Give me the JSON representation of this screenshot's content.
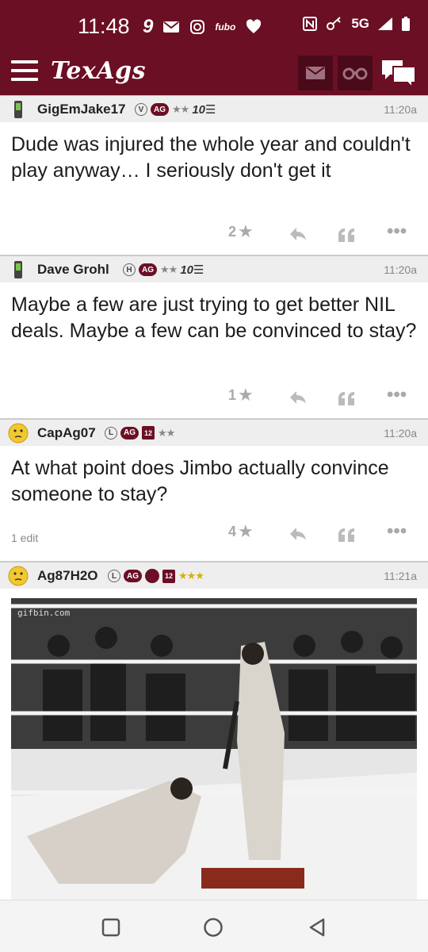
{
  "status_bar": {
    "time": "11:48",
    "notif_9": "9",
    "fubo": "fubo",
    "network": "5G"
  },
  "app": {
    "logo": "TexAgs"
  },
  "posts": [
    {
      "username": "GigEmJake17",
      "badge_letter": "V",
      "badge_ag": "AG",
      "badge_stars": "★★",
      "badge_10": "10☰",
      "time": "11:20a",
      "text": "Dude was injured the whole year and couldn't play anyway… I seriously don't get it",
      "stars_count": "2"
    },
    {
      "username": "Dave Grohl",
      "badge_letter": "H",
      "badge_ag": "AG",
      "badge_stars": "★★",
      "badge_10": "10☰",
      "time": "11:20a",
      "text": "Maybe a few are just trying to get better NIL deals. Maybe a few can be convinced to stay?",
      "stars_count": "1"
    },
    {
      "username": "CapAg07",
      "badge_letter": "L",
      "badge_ag": "AG",
      "badge_12": "12",
      "badge_stars": "★★",
      "time": "11:20a",
      "text": "At what point does Jimbo actually convince someone to stay?",
      "stars_count": "4",
      "edit_note": "1 edit"
    },
    {
      "username": "Ag87H2O",
      "badge_letter": "L",
      "badge_ag": "AG",
      "badge_12": "12",
      "badge_stars": "★★★",
      "time": "11:21a",
      "gif_watermark": "gifbin.com"
    }
  ],
  "colors": {
    "brand_maroon": "#6b0f24",
    "header_grey": "#eeeeee",
    "gold_star": "#d8b000"
  }
}
